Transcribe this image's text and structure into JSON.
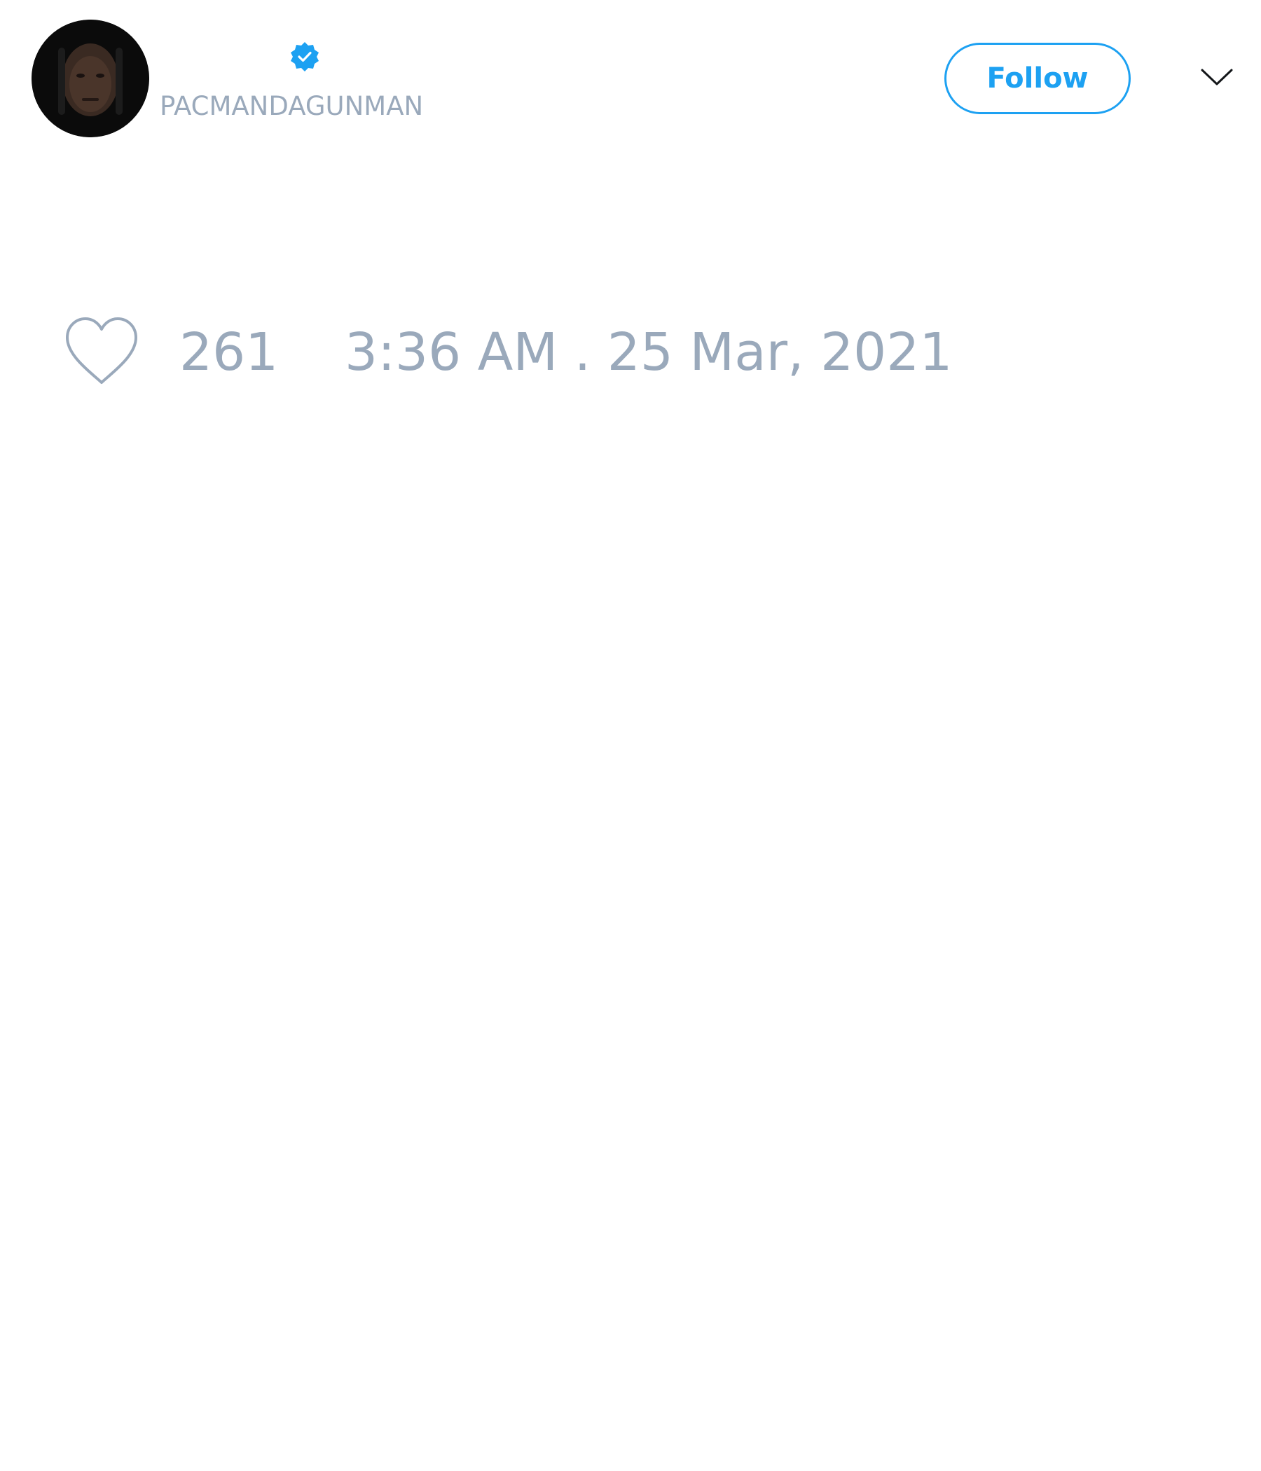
{
  "user": {
    "display_name": "",
    "handle": "PACMANDAGUNMAN",
    "verified": true
  },
  "header": {
    "follow_label": "Follow",
    "menu_icon": "chevron-down-icon"
  },
  "stats": {
    "like_icon": "heart-icon",
    "like_count": "261",
    "timestamp": "3:36 AM . 25 Mar, 2021"
  },
  "colors": {
    "accent": "#1da1f2",
    "muted_text": "#9aa9bb",
    "background": "#ffffff"
  }
}
